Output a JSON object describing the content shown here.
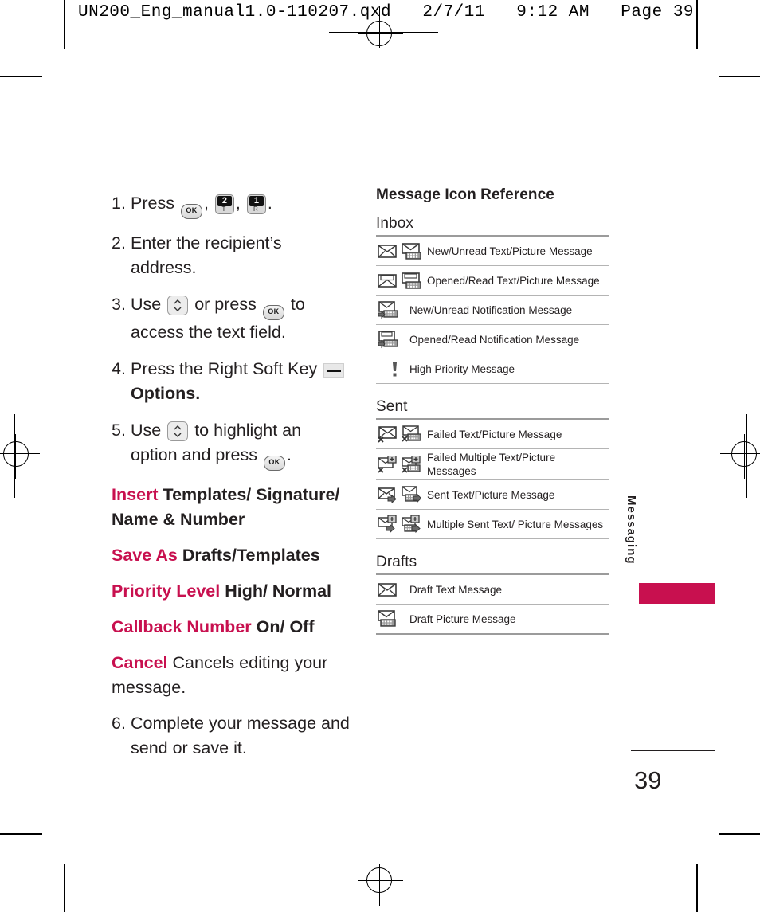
{
  "header": {
    "text": "UN200_Eng_manual1.0-110207.qxd   2/7/11   9:12 AM   Page 39"
  },
  "steps": [
    {
      "num": "1.",
      "lines": [
        "Press"
      ],
      "trailing": ".",
      "keys": [
        "ok",
        "two",
        "one"
      ]
    },
    {
      "num": "2.",
      "lines": [
        "Enter the recipient’s address."
      ]
    },
    {
      "num": "3.",
      "lines": [
        "Use",
        "or press",
        "to",
        "access the text field."
      ]
    },
    {
      "num": "4.",
      "lines": [
        "Press the Right Soft Key",
        "Options."
      ]
    },
    {
      "num": "5.",
      "lines": [
        "Use",
        "to highlight an",
        "option and press",
        "."
      ]
    },
    {
      "num": "6.",
      "lines": [
        "Complete your message and",
        "send or save it."
      ]
    }
  ],
  "step_text": {
    "s1_press": "Press",
    "s1_period": ".",
    "s2": "Enter the recipient’s address.",
    "s3_use": "Use",
    "s3_orpress": "or press",
    "s3_to": "to",
    "s3_line2": "access the text field.",
    "s4_line1": "Press the Right Soft Key",
    "s4_line2": "Options.",
    "s5_use": "Use",
    "s5_highlight": "to highlight an",
    "s5_line2a": "option and press",
    "s5_line2b": ".",
    "s6_line1": "Complete your message and",
    "s6_line2": "send or save it."
  },
  "keys": {
    "ok_label": "OK",
    "two_digit": "2",
    "two_sub": "T",
    "one_digit": "1",
    "one_sub": "R"
  },
  "options": [
    {
      "term": "Insert",
      "value": "Templates/ Signature/",
      "value2": "Name & Number",
      "bold_value": true
    },
    {
      "term": "Save As",
      "value": "Drafts/Templates",
      "bold_value": true
    },
    {
      "term": "Priority Level",
      "value": "High/ Normal",
      "bold_value": true
    },
    {
      "term": "Callback Number",
      "value": "On/ Off",
      "bold_value": true
    },
    {
      "term": "Cancel",
      "value": "Cancels editing your",
      "value2": "message.",
      "bold_value": false
    }
  ],
  "reference": {
    "title": "Message Icon Reference",
    "groups": [
      {
        "name": "Inbox",
        "rows": [
          {
            "label": "New/Unread Text/Picture Message",
            "icons": [
              "envelope-closed",
              "picture-new"
            ]
          },
          {
            "label": "Opened/Read Text/Picture Message",
            "icons": [
              "envelope-open",
              "picture-open"
            ]
          },
          {
            "label": "New/Unread Notification Message",
            "icons": [
              "notification-new"
            ]
          },
          {
            "label": "Opened/Read Notification Message",
            "icons": [
              "notification-open"
            ]
          },
          {
            "label": "High Priority Message",
            "icons": [
              "exclamation"
            ]
          }
        ]
      },
      {
        "name": "Sent",
        "rows": [
          {
            "label": "Failed Text/Picture Message",
            "icons": [
              "envelope-failed",
              "picture-failed"
            ]
          },
          {
            "label": "Failed Multiple Text/Picture",
            "label2": "Messages",
            "icons": [
              "envelope-failed-multi",
              "picture-failed-multi"
            ]
          },
          {
            "label": "Sent Text/Picture Message",
            "icons": [
              "envelope-sent",
              "picture-sent"
            ]
          },
          {
            "label": "Multiple Sent Text/ Picture Messages",
            "icons": [
              "envelope-sent-multi",
              "picture-sent-multi"
            ]
          }
        ]
      },
      {
        "name": "Drafts",
        "rows": [
          {
            "label": "Draft Text Message",
            "icons": [
              "envelope-draft"
            ]
          },
          {
            "label": "Draft Picture Message",
            "icons": [
              "picture-draft"
            ]
          }
        ]
      }
    ]
  },
  "side_tab": {
    "label": "Messaging",
    "accent_color": "#c8104f"
  },
  "page_number": "39"
}
